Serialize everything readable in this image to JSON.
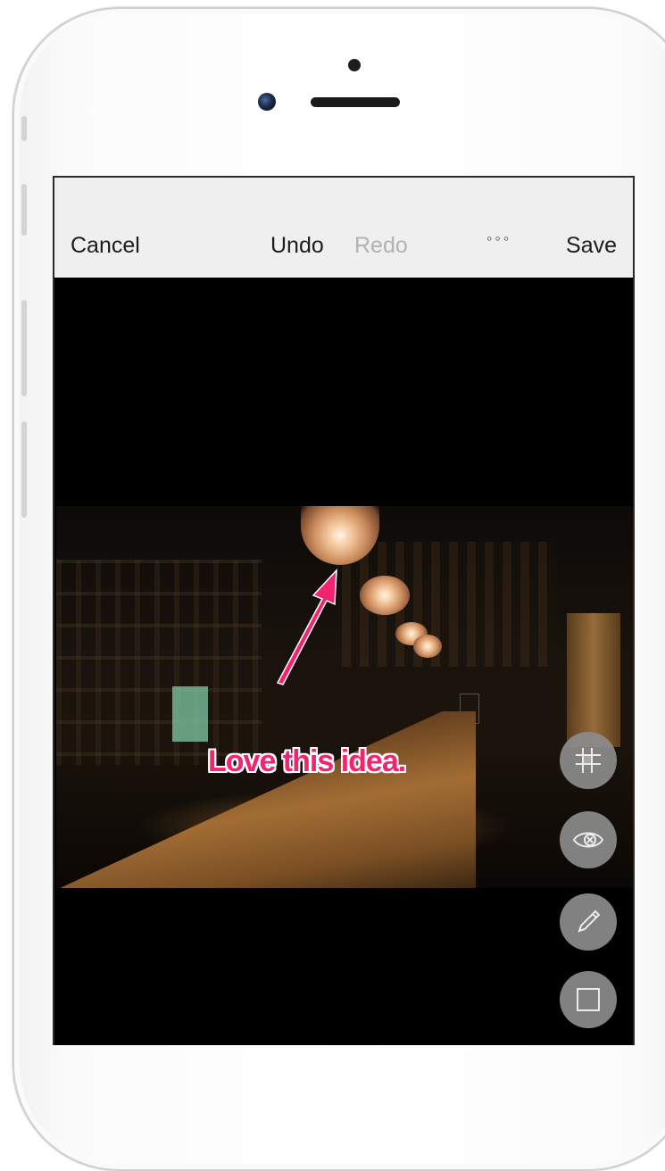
{
  "toolbar": {
    "cancel_label": "Cancel",
    "undo_label": "Undo",
    "redo_label": "Redo",
    "more_label": "◦◦◦",
    "save_label": "Save"
  },
  "annotation": {
    "text": "Love this idea.",
    "color": "#f2246f"
  },
  "tools": [
    {
      "icon": "pixelate-icon"
    },
    {
      "icon": "blur-icon"
    },
    {
      "icon": "pencil-icon"
    },
    {
      "icon": "rectangle-icon"
    }
  ],
  "colors": {
    "toolbar_bg": "#efefef",
    "redo_disabled": "#b2b2b2",
    "tool_bg": "#8c8c8c"
  }
}
